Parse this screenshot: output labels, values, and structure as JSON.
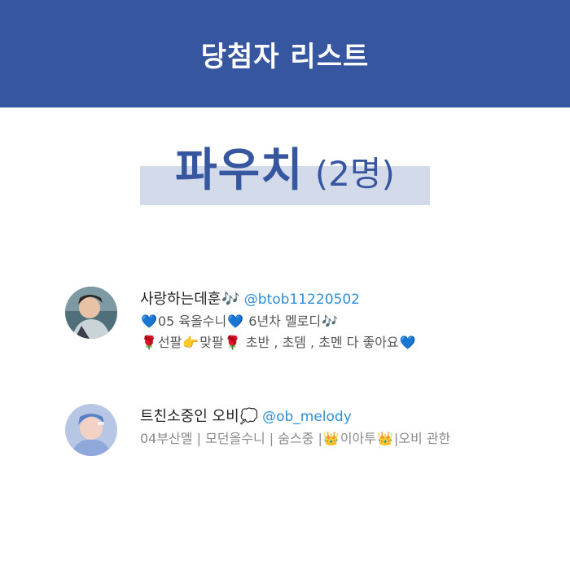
{
  "header": {
    "title": "당첨자 리스트"
  },
  "section": {
    "title": "파우치",
    "count": "(2명)"
  },
  "winners": [
    {
      "name": "사랑하는데훈",
      "name_icon": "music-note-icon",
      "handle": "@btob11220502",
      "bio_lines": [
        [
          "💙",
          "05 육올수니",
          "💙",
          " 6년차 멜로디",
          "🎶"
        ],
        [
          "🌹",
          "선팔",
          "👉",
          "맞팔",
          "🌹",
          " 초반 , 초뎀 , 초멘 다 좋아요",
          "💙"
        ]
      ]
    },
    {
      "name": "트친소중인 오비",
      "name_icon": "speech-bubble-icon",
      "handle": "@ob_melody",
      "bio_lines": [
        [
          "04부산멜 | 모던올수니 | 숨스중 |",
          "👑",
          "이아투",
          "👑",
          "|오비 관한"
        ]
      ]
    }
  ],
  "colors": {
    "header_bg": "#3656a0",
    "accent": "#3656a0",
    "highlight": "#d3dae9",
    "handle": "#2f8fd6"
  }
}
